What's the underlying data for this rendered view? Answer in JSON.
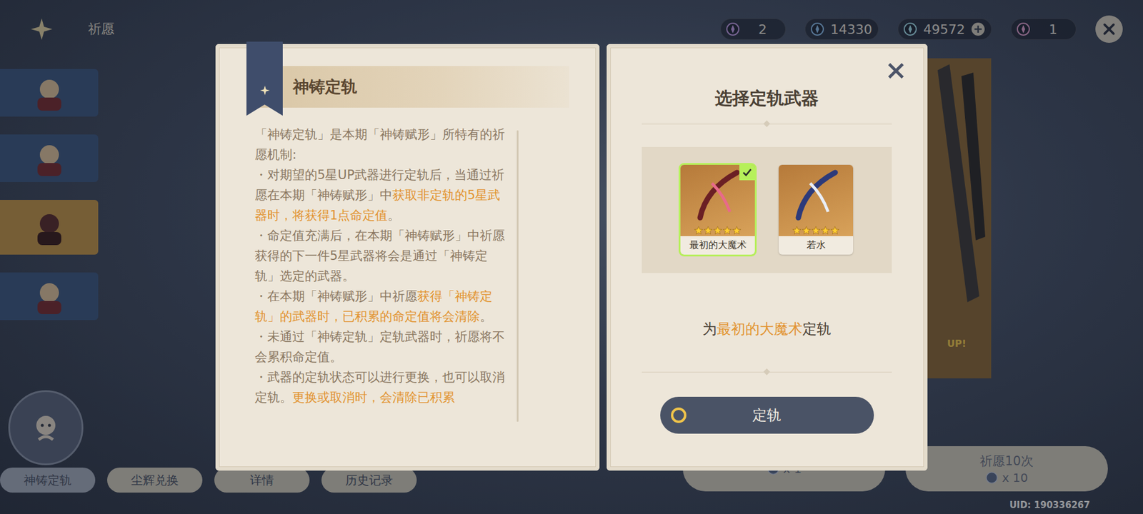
{
  "header": {
    "title": "祈愿",
    "currencies": [
      {
        "kind": "starglitter",
        "value": "2",
        "addable": false
      },
      {
        "kind": "stardust",
        "value": "14330",
        "addable": false
      },
      {
        "kind": "primogem",
        "value": "49572",
        "addable": true
      },
      {
        "kind": "fate",
        "value": "1",
        "addable": false
      }
    ]
  },
  "banners": [
    {
      "selected": false
    },
    {
      "selected": false
    },
    {
      "selected": true
    },
    {
      "selected": false
    }
  ],
  "banner_art": {
    "tag": "UP!"
  },
  "footer_buttons": [
    "神铸定轨",
    "尘辉兑换",
    "详情",
    "历史记录"
  ],
  "wish_buttons": [
    {
      "label": "",
      "cost": "x 1"
    },
    {
      "label": "祈愿10次",
      "cost": "x 10"
    }
  ],
  "uid": "UID: 190336267",
  "dialog": {
    "left": {
      "title": "神铸定轨",
      "paragraphs": [
        [
          {
            "text": "「神铸定轨」是本期「神铸赋形」所特有的祈愿机制:",
            "highlight": false
          }
        ],
        [
          {
            "text": "・对期望的5星UP武器进行定轨后，当通过祈愿在本期「神铸赋形」中",
            "highlight": false
          },
          {
            "text": "获取非定轨的5星武器时，将获得1点命定值",
            "highlight": true
          },
          {
            "text": "。",
            "highlight": false
          }
        ],
        [
          {
            "text": "・命定值充满后，在本期「神铸赋形」中祈愿获得的下一件5星武器将会是通过「神铸定轨」选定的武器。",
            "highlight": false
          }
        ],
        [
          {
            "text": "・在本期「神铸赋形」中祈愿",
            "highlight": false
          },
          {
            "text": "获得「神铸定轨」的武器时，已积累的命定值将会清除",
            "highlight": true
          },
          {
            "text": "。",
            "highlight": false
          }
        ],
        [
          {
            "text": "・未通过「神铸定轨」定轨武器时，祈愿将不会累积命定值。",
            "highlight": false
          }
        ],
        [
          {
            "text": "・武器的定轨状态可以进行更换，也可以取消定轨。",
            "highlight": false
          },
          {
            "text": "更换或取消时，会清除已积累",
            "highlight": true
          }
        ]
      ]
    },
    "right": {
      "title": "选择定轨武器",
      "weapons": [
        {
          "name": "最初的大魔术",
          "stars": 5,
          "selected": true
        },
        {
          "name": "若水",
          "stars": 5,
          "selected": false
        }
      ],
      "caption": {
        "prefix": "为",
        "suffix": "定轨"
      },
      "button": "定轨"
    }
  }
}
